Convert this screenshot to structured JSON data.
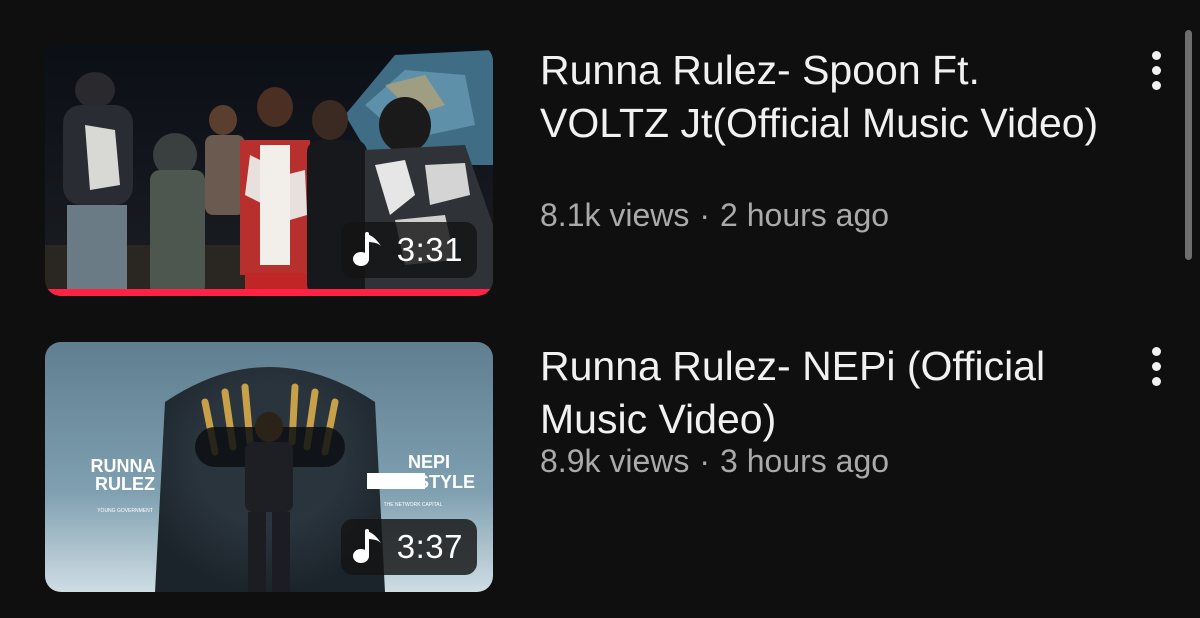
{
  "videos": [
    {
      "title": "Runna Rulez- Spoon Ft. VOLTZ Jt(Official Music Video)",
      "views": "8.1k views",
      "separator": "·",
      "age": "2 hours ago",
      "duration": "3:31",
      "duration_icon": "music-note-icon",
      "watched_fraction": 1.0,
      "menu_icon": "more-vert-icon"
    },
    {
      "title": "Runna Rulez- NEPi (Official Music Video)",
      "views": "8.9k views",
      "separator": "·",
      "age": "3 hours ago",
      "duration": "3:37",
      "duration_icon": "music-note-icon",
      "menu_icon": "more-vert-icon",
      "thumbnail_text": {
        "artist_line1": "RUNNA",
        "artist_line2": "RULEZ",
        "artist_sub": "YOUNG GOVERNMENT",
        "song_line1": "NEPI",
        "song_line2": "STYLE",
        "song_sub": "THE NETWORK CAPITAL"
      }
    }
  ],
  "colors": {
    "background": "#0f0f0f",
    "title": "#f1f1f1",
    "meta": "#aaaaaa",
    "progress": "#ff2244"
  }
}
